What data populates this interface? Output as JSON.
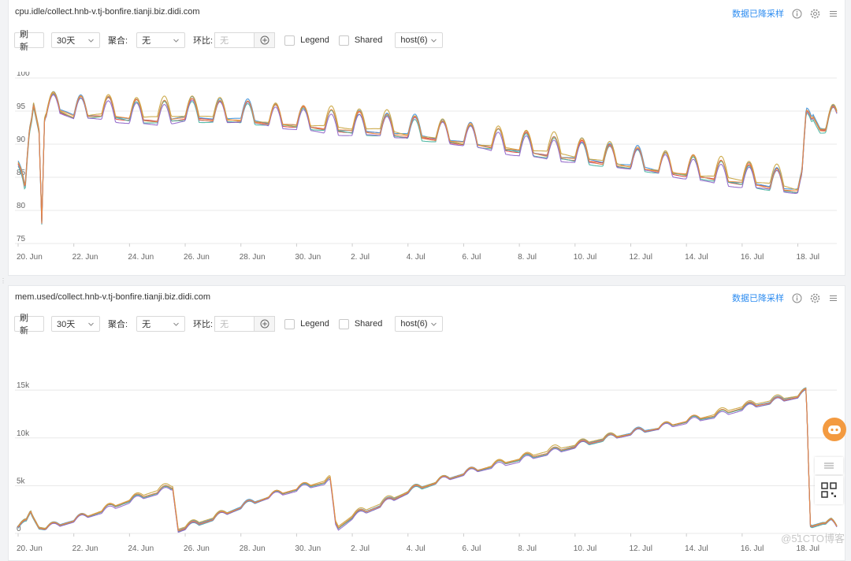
{
  "colors": {
    "series": [
      "#e03c31",
      "#3b8fd8",
      "#45b29d",
      "#c8a23a",
      "#8e63c9",
      "#f08a3c"
    ],
    "accent": "#2d8cf0",
    "grid": "#e8e8e8",
    "float_button": "#f39a40"
  },
  "panels": [
    {
      "title": "cpu.idle/collect.hnb-v.tj-bonfire.tianji.biz.didi.com",
      "downsample_label": "数据已降采样",
      "toolbar": {
        "refresh": "刷 新",
        "range": "30天",
        "agg_label": "聚合:",
        "agg_value": "无",
        "cmp_label": "环比:",
        "cmp_placeholder": "无",
        "legend": "Legend",
        "shared": "Shared",
        "hosts": "host(6)"
      }
    },
    {
      "title": "mem.used/collect.hnb-v.tj-bonfire.tianji.biz.didi.com",
      "downsample_label": "数据已降采样",
      "toolbar": {
        "refresh": "刷 新",
        "range": "30天",
        "agg_label": "聚合:",
        "agg_value": "无",
        "cmp_label": "环比:",
        "cmp_placeholder": "无",
        "legend": "Legend",
        "shared": "Shared",
        "hosts": "host(6)"
      }
    }
  ],
  "icons": [
    "info-icon",
    "gear-icon",
    "menu-icon",
    "plus-circle-icon",
    "chevron-down-icon",
    "qr-code-icon"
  ],
  "watermark": "@51CTO博客",
  "chart_data": [
    {
      "type": "line",
      "x_range": [
        0,
        29.4
      ],
      "x_ticks": [
        "20. Jun",
        "22. Jun",
        "24. Jun",
        "26. Jun",
        "28. Jun",
        "30. Jun",
        "2. Jul",
        "4. Jul",
        "6. Jul",
        "8. Jul",
        "10. Jul",
        "12. Jul",
        "14. Jul",
        "16. Jul",
        "18. Jul"
      ],
      "x_tick_days": [
        0,
        2,
        4,
        6,
        8,
        10,
        12,
        14,
        16,
        18,
        20,
        22,
        24,
        26,
        28
      ],
      "y_ticks": [
        75,
        80,
        85,
        90,
        95,
        100
      ],
      "y_tick_labels": [
        "75",
        "80",
        "85",
        "90",
        "95",
        "100"
      ],
      "ylim": [
        75,
        100
      ],
      "grid": true,
      "legend": "hidden",
      "profile": {
        "x": [
          0.0,
          0.25,
          0.4,
          0.55,
          0.75,
          0.85,
          0.95,
          1.2,
          1.45,
          2.0,
          3.0,
          4.0,
          5.0,
          6.0,
          7.0,
          8.0,
          9.0,
          10.0,
          11.0,
          12.0,
          13.0,
          14.0,
          15.0,
          16.0,
          17.0,
          18.0,
          19.0,
          20.0,
          21.0,
          22.0,
          23.0,
          24.0,
          25.0,
          26.0,
          27.0,
          27.95,
          28.15,
          28.3,
          28.55,
          28.8,
          29.05,
          29.2,
          29.4
        ],
        "y": [
          88,
          81,
          91,
          97,
          93,
          79,
          95,
          95.5,
          96,
          95,
          95.2,
          94.6,
          94.4,
          94.8,
          94.6,
          94.4,
          94.0,
          93.6,
          93.2,
          92.8,
          92.6,
          92.1,
          91.6,
          91.0,
          90.4,
          89.8,
          89.2,
          88.6,
          88.0,
          87.4,
          86.8,
          86.2,
          85.6,
          85.0,
          84.4,
          83.8,
          84.2,
          93,
          95,
          93,
          93,
          93.5,
          94
        ],
        "daily_amplitude": 2.8
      },
      "series": [
        {
          "offset": 0.0
        },
        {
          "offset": 0.35
        },
        {
          "offset": -0.3
        },
        {
          "offset": 0.6
        },
        {
          "offset": -0.55
        },
        {
          "offset": 0.15
        }
      ]
    },
    {
      "type": "line",
      "x_range": [
        0,
        29.4
      ],
      "x_ticks": [
        "20. Jun",
        "22. Jun",
        "24. Jun",
        "26. Jun",
        "28. Jun",
        "30. Jun",
        "2. Jul",
        "4. Jul",
        "6. Jul",
        "8. Jul",
        "10. Jul",
        "12. Jul",
        "14. Jul",
        "16. Jul",
        "18. Jul"
      ],
      "x_tick_days": [
        0,
        2,
        4,
        6,
        8,
        10,
        12,
        14,
        16,
        18,
        20,
        22,
        24,
        26,
        28
      ],
      "y_ticks": [
        0,
        5000,
        10000,
        15000
      ],
      "y_tick_labels": [
        "0",
        "5k",
        "10k",
        "15k"
      ],
      "ylim": [
        0,
        16000
      ],
      "grid": true,
      "legend": "hidden",
      "profile": {
        "x": [
          0.0,
          0.3,
          0.45,
          0.75,
          0.95,
          1.3,
          2.0,
          3.0,
          4.0,
          5.0,
          5.55,
          5.75,
          5.95,
          7.0,
          8.0,
          9.0,
          10.0,
          11.2,
          11.4,
          11.5,
          12.0,
          13.0,
          14.0,
          15.0,
          16.0,
          17.0,
          18.0,
          19.0,
          20.0,
          21.0,
          22.0,
          23.0,
          24.0,
          25.0,
          26.0,
          27.0,
          28.0,
          28.3,
          28.45,
          28.9,
          29.2,
          29.4
        ],
        "y": [
          800,
          1100,
          2300,
          700,
          600,
          800,
          1400,
          2400,
          3500,
          4400,
          4900,
          400,
          600,
          1600,
          2800,
          3900,
          4700,
          5600,
          1000,
          700,
          1800,
          3000,
          4400,
          5400,
          6300,
          7100,
          7800,
          8500,
          9200,
          9900,
          10500,
          11100,
          11800,
          12400,
          13200,
          13800,
          14400,
          14800,
          800,
          1200,
          1200,
          600
        ],
        "daily_amplitude": 450
      },
      "series": [
        {
          "offset": 0
        },
        {
          "offset": 120
        },
        {
          "offset": -100
        },
        {
          "offset": 220
        },
        {
          "offset": -180
        },
        {
          "offset": 60
        }
      ]
    }
  ]
}
